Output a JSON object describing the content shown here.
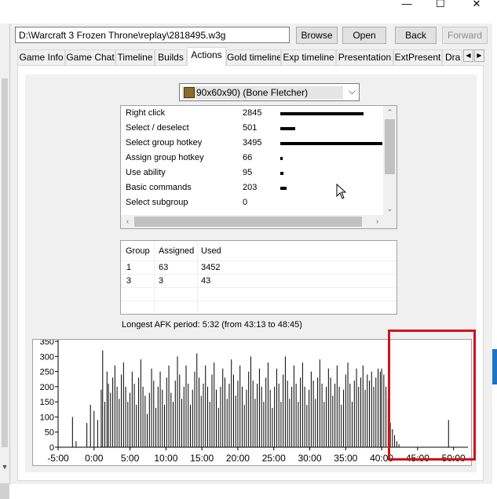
{
  "window": {
    "minimize_glyph": "—",
    "maximize_glyph": "☐",
    "close_glyph": "✕"
  },
  "toolbar": {
    "path_value": "D:\\Warcraft 3 Frozen Throne\\replay\\2818495.w3g",
    "browse_label": "Browse",
    "open_label": "Open",
    "back_label": "Back",
    "forward_label": "Forward"
  },
  "tabs": [
    {
      "label": "Game Info"
    },
    {
      "label": "Game Chat"
    },
    {
      "label": "Timeline"
    },
    {
      "label": "Builds"
    },
    {
      "label": "Actions"
    },
    {
      "label": "Gold timeline"
    },
    {
      "label": "Exp timeline"
    },
    {
      "label": "Presentation"
    },
    {
      "label": "ExtPresent"
    },
    {
      "label": "Dra"
    }
  ],
  "active_tab": "Actions",
  "player_select": {
    "value": "90x60x90) (Bone Fletcher)"
  },
  "actions": [
    {
      "label": "Right click",
      "count": 2845
    },
    {
      "label": "Select / deselect",
      "count": 501
    },
    {
      "label": "Select group hotkey",
      "count": 3495
    },
    {
      "label": "Assign group hotkey",
      "count": 66
    },
    {
      "label": "Use ability",
      "count": 95
    },
    {
      "label": "Basic commands",
      "count": 203
    },
    {
      "label": "Select subgroup",
      "count": 0
    }
  ],
  "groups": {
    "headers": [
      "Group",
      "Assigned",
      "Used"
    ],
    "rows": [
      [
        "1",
        "63",
        "3452"
      ],
      [
        "3",
        "3",
        "43"
      ]
    ]
  },
  "afk_text": "Longest AFK period: 5:32 (from 43:13 to 48:45)",
  "chart_data": {
    "type": "bar",
    "title": "",
    "xlabel": "",
    "ylabel": "",
    "xlim": [
      -5,
      52
    ],
    "ylim": [
      0,
      350
    ],
    "x_tick_labels": [
      "-5:00",
      "0:00",
      "5:00",
      "10:00",
      "15:00",
      "20:00",
      "25:00",
      "30:00",
      "35:00",
      "40:00",
      "45:00",
      "50:00"
    ],
    "y_tick_labels": [
      "0",
      "50",
      "100",
      "150",
      "200",
      "250",
      "300",
      "350"
    ],
    "series": [
      {
        "values": [
          [
            -3.0,
            100
          ],
          [
            -2.5,
            20
          ],
          [
            -1.0,
            80
          ],
          [
            -0.5,
            140
          ],
          [
            0.0,
            120
          ],
          [
            0.5,
            90
          ],
          [
            1.0,
            190
          ],
          [
            1.2,
            320
          ],
          [
            1.5,
            150
          ],
          [
            1.8,
            250
          ],
          [
            2.0,
            210
          ],
          [
            2.3,
            180
          ],
          [
            2.6,
            230
          ],
          [
            2.9,
            270
          ],
          [
            3.2,
            200
          ],
          [
            3.5,
            160
          ],
          [
            3.8,
            240
          ],
          [
            4.1,
            280
          ],
          [
            4.4,
            200
          ],
          [
            4.7,
            150
          ],
          [
            5.0,
            180
          ],
          [
            5.3,
            250
          ],
          [
            5.6,
            210
          ],
          [
            5.9,
            140
          ],
          [
            6.2,
            230
          ],
          [
            6.5,
            290
          ],
          [
            6.8,
            200
          ],
          [
            7.1,
            170
          ],
          [
            7.4,
            110
          ],
          [
            7.7,
            180
          ],
          [
            8.0,
            260
          ],
          [
            8.3,
            220
          ],
          [
            8.6,
            130
          ],
          [
            8.9,
            200
          ],
          [
            9.2,
            250
          ],
          [
            9.5,
            190
          ],
          [
            9.8,
            140
          ],
          [
            10.1,
            230
          ],
          [
            10.4,
            270
          ],
          [
            10.7,
            180
          ],
          [
            11.0,
            150
          ],
          [
            11.3,
            220
          ],
          [
            11.6,
            300
          ],
          [
            11.9,
            240
          ],
          [
            12.2,
            160
          ],
          [
            12.5,
            200
          ],
          [
            12.8,
            270
          ],
          [
            13.1,
            210
          ],
          [
            13.4,
            140
          ],
          [
            13.7,
            190
          ],
          [
            14.0,
            250
          ],
          [
            14.3,
            310
          ],
          [
            14.6,
            230
          ],
          [
            14.9,
            170
          ],
          [
            15.2,
            210
          ],
          [
            15.5,
            270
          ],
          [
            15.8,
            200
          ],
          [
            16.1,
            150
          ],
          [
            16.4,
            240
          ],
          [
            16.7,
            280
          ],
          [
            17.0,
            190
          ],
          [
            17.3,
            130
          ],
          [
            17.6,
            200
          ],
          [
            17.9,
            260
          ],
          [
            18.2,
            230
          ],
          [
            18.5,
            160
          ],
          [
            18.8,
            210
          ],
          [
            19.1,
            290
          ],
          [
            19.4,
            240
          ],
          [
            19.7,
            170
          ],
          [
            20.0,
            220
          ],
          [
            20.3,
            270
          ],
          [
            20.6,
            200
          ],
          [
            20.9,
            140
          ],
          [
            21.2,
            190
          ],
          [
            21.5,
            250
          ],
          [
            21.8,
            300
          ],
          [
            22.1,
            220
          ],
          [
            22.4,
            160
          ],
          [
            22.7,
            210
          ],
          [
            23.0,
            260
          ],
          [
            23.3,
            200
          ],
          [
            23.6,
            150
          ],
          [
            23.9,
            230
          ],
          [
            24.2,
            280
          ],
          [
            24.5,
            190
          ],
          [
            24.8,
            130
          ],
          [
            25.1,
            200
          ],
          [
            25.4,
            260
          ],
          [
            25.7,
            210
          ],
          [
            26.0,
            150
          ],
          [
            26.3,
            240
          ],
          [
            26.6,
            300
          ],
          [
            26.9,
            220
          ],
          [
            27.2,
            160
          ],
          [
            27.5,
            200
          ],
          [
            27.8,
            270
          ],
          [
            28.1,
            210
          ],
          [
            28.4,
            150
          ],
          [
            28.7,
            230
          ],
          [
            29.0,
            280
          ],
          [
            29.3,
            200
          ],
          [
            29.6,
            140
          ],
          [
            29.9,
            190
          ],
          [
            30.2,
            250
          ],
          [
            30.5,
            220
          ],
          [
            30.8,
            160
          ],
          [
            31.1,
            230
          ],
          [
            31.4,
            290
          ],
          [
            31.7,
            210
          ],
          [
            32.0,
            150
          ],
          [
            32.3,
            200
          ],
          [
            32.6,
            260
          ],
          [
            32.9,
            230
          ],
          [
            33.2,
            170
          ],
          [
            33.5,
            210
          ],
          [
            33.8,
            270
          ],
          [
            34.1,
            200
          ],
          [
            34.4,
            140
          ],
          [
            34.7,
            190
          ],
          [
            35.0,
            240
          ],
          [
            35.3,
            280
          ],
          [
            35.6,
            210
          ],
          [
            35.9,
            150
          ],
          [
            36.2,
            220
          ],
          [
            36.5,
            260
          ],
          [
            36.8,
            200
          ],
          [
            37.1,
            230
          ],
          [
            37.4,
            270
          ],
          [
            37.7,
            190
          ],
          [
            38.0,
            240
          ],
          [
            38.3,
            220
          ],
          [
            38.6,
            250
          ],
          [
            38.9,
            200
          ],
          [
            39.2,
            230
          ],
          [
            39.5,
            260
          ],
          [
            39.8,
            250
          ],
          [
            40.0,
            260
          ],
          [
            40.3,
            240
          ],
          [
            40.6,
            200
          ],
          [
            40.9,
            160
          ],
          [
            41.2,
            80
          ],
          [
            41.5,
            60
          ],
          [
            41.8,
            40
          ],
          [
            42.1,
            20
          ],
          [
            42.4,
            10
          ],
          [
            49.3,
            90
          ]
        ]
      }
    ]
  }
}
